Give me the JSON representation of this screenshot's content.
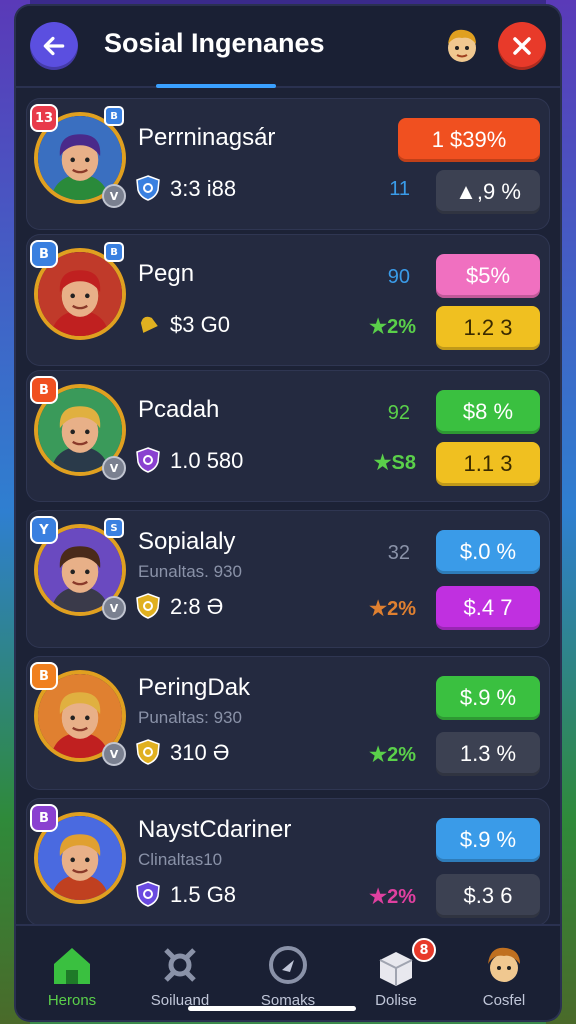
{
  "header": {
    "title": "Sosial Ingenanes",
    "back_icon": "arrow-left-icon",
    "profile_icon": "avatar-icon",
    "close_icon": "close-icon"
  },
  "players": [
    {
      "rank_badge": "13",
      "rank_color": "#e83a4a",
      "corner_badge": "B",
      "level_badge": "V",
      "name": "Perrninagsár",
      "subtitle": "",
      "stat_icon": "shield-icon",
      "stat_icon_color": "#3a80e0",
      "stat_text": "3:3 i88",
      "mid_value": "11",
      "mid_color": "#3a9be8",
      "mid_value2": "",
      "mid2_color": "#5ad04a",
      "pill_top": "1   $39%",
      "pill_top_color": "#f05020",
      "pill_bottom": "▲,9 %",
      "pill_bottom_color": "#3c4152",
      "avatar_bg": "#3a6fc0",
      "hair_color": "#4a2a8a",
      "shirt_color": "#2a8a3a"
    },
    {
      "rank_badge": "B",
      "rank_color": "#3a80e0",
      "corner_badge": "B",
      "level_badge": "",
      "name": "Pegn",
      "subtitle": "",
      "stat_icon": "bell-icon",
      "stat_icon_color": "#e0b020",
      "stat_text": "$3 G0",
      "mid_value": "90",
      "mid_color": "#3a9be8",
      "mid_value2": "★2%",
      "mid2_color": "#5ad04a",
      "pill_top": "$5%",
      "pill_top_color": "#f070c0",
      "pill_bottom": "1.2 3",
      "pill_bottom_color": "#f0c020",
      "avatar_bg": "#c03a2a",
      "hair_color": "#c02020",
      "shirt_color": "#c02020"
    },
    {
      "rank_badge": "B",
      "rank_color": "#f05020",
      "corner_badge": "",
      "level_badge": "V",
      "name": "Pcadah",
      "subtitle": "",
      "stat_icon": "shield-icon",
      "stat_icon_color": "#8a40d0",
      "stat_text": "1.0 580",
      "mid_value": "92",
      "mid_color": "#5ad04a",
      "mid_value2": "★S8",
      "mid2_color": "#5ad04a",
      "pill_top": "$8 %",
      "pill_top_color": "#3ac040",
      "pill_bottom": "1.1 3",
      "pill_bottom_color": "#f0c020",
      "avatar_bg": "#3a9a5a",
      "hair_color": "#e0b040",
      "shirt_color": "#2a3a4a"
    },
    {
      "rank_badge": "Y",
      "rank_color": "#3a80e0",
      "corner_badge": "S",
      "level_badge": "V",
      "name": "Sopialaly",
      "subtitle": "Eunaltas. 930",
      "stat_icon": "shield-icon",
      "stat_icon_color": "#e0b020",
      "stat_text": "2:8 Ə",
      "mid_value": "32",
      "mid_color": "#8a92a8",
      "mid_value2": "★2%",
      "mid2_color": "#e08030",
      "pill_top": "$.0 %",
      "pill_top_color": "#3a9be8",
      "pill_bottom": "$.4 7",
      "pill_bottom_color": "#c030e0",
      "avatar_bg": "#6a4ac0",
      "hair_color": "#4a2a1a",
      "shirt_color": "#3a3a4a"
    },
    {
      "rank_badge": "B",
      "rank_color": "#f08020",
      "corner_badge": "",
      "level_badge": "V",
      "name": "PeringDak",
      "subtitle": "Punaltas: 930",
      "stat_icon": "shield-icon",
      "stat_icon_color": "#e0b020",
      "stat_text": "310 Ə",
      "mid_value": "",
      "mid_color": "#5ad04a",
      "mid_value2": "★2%",
      "mid2_color": "#5ad04a",
      "pill_top": "$.9 %",
      "pill_top_color": "#3ac040",
      "pill_bottom": "1.3 %",
      "pill_bottom_color": "#3c4152",
      "avatar_bg": "#e08030",
      "hair_color": "#e0b040",
      "shirt_color": "#c02020"
    },
    {
      "rank_badge": "B",
      "rank_color": "#8a40d0",
      "corner_badge": "",
      "level_badge": "",
      "name": "NaystCdariner",
      "subtitle": "Clinaltas10",
      "stat_icon": "shield-icon",
      "stat_icon_color": "#6a4ae0",
      "stat_text": "1.5 G8",
      "mid_value": "",
      "mid_color": "#e040a0",
      "mid_value2": "★2%",
      "mid2_color": "#e040a0",
      "pill_top": "$.9 %",
      "pill_top_color": "#3a9be8",
      "pill_bottom": "$.3 6",
      "pill_bottom_color": "#3c4152",
      "avatar_bg": "#4a6ae0",
      "hair_color": "#e0a030",
      "shirt_color": "#c04020"
    }
  ],
  "nav": [
    {
      "label": "Herons",
      "icon": "home-icon",
      "active": true
    },
    {
      "label": "Soiluand",
      "icon": "network-icon",
      "active": false
    },
    {
      "label": "Somaks",
      "icon": "compass-icon",
      "active": false
    },
    {
      "label": "Dolise",
      "icon": "box-icon",
      "active": false,
      "badge": "8"
    },
    {
      "label": "Cosfel",
      "icon": "profile-icon",
      "active": false
    }
  ]
}
